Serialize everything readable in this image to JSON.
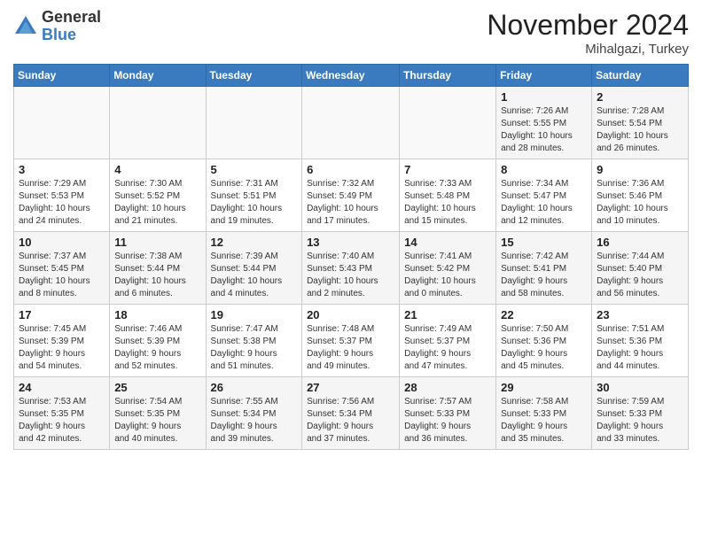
{
  "header": {
    "logo_general": "General",
    "logo_blue": "Blue",
    "month": "November 2024",
    "location": "Mihalgazi, Turkey"
  },
  "weekdays": [
    "Sunday",
    "Monday",
    "Tuesday",
    "Wednesday",
    "Thursday",
    "Friday",
    "Saturday"
  ],
  "weeks": [
    [
      {
        "day": "",
        "info": ""
      },
      {
        "day": "",
        "info": ""
      },
      {
        "day": "",
        "info": ""
      },
      {
        "day": "",
        "info": ""
      },
      {
        "day": "",
        "info": ""
      },
      {
        "day": "1",
        "info": "Sunrise: 7:26 AM\nSunset: 5:55 PM\nDaylight: 10 hours\nand 28 minutes."
      },
      {
        "day": "2",
        "info": "Sunrise: 7:28 AM\nSunset: 5:54 PM\nDaylight: 10 hours\nand 26 minutes."
      }
    ],
    [
      {
        "day": "3",
        "info": "Sunrise: 7:29 AM\nSunset: 5:53 PM\nDaylight: 10 hours\nand 24 minutes."
      },
      {
        "day": "4",
        "info": "Sunrise: 7:30 AM\nSunset: 5:52 PM\nDaylight: 10 hours\nand 21 minutes."
      },
      {
        "day": "5",
        "info": "Sunrise: 7:31 AM\nSunset: 5:51 PM\nDaylight: 10 hours\nand 19 minutes."
      },
      {
        "day": "6",
        "info": "Sunrise: 7:32 AM\nSunset: 5:49 PM\nDaylight: 10 hours\nand 17 minutes."
      },
      {
        "day": "7",
        "info": "Sunrise: 7:33 AM\nSunset: 5:48 PM\nDaylight: 10 hours\nand 15 minutes."
      },
      {
        "day": "8",
        "info": "Sunrise: 7:34 AM\nSunset: 5:47 PM\nDaylight: 10 hours\nand 12 minutes."
      },
      {
        "day": "9",
        "info": "Sunrise: 7:36 AM\nSunset: 5:46 PM\nDaylight: 10 hours\nand 10 minutes."
      }
    ],
    [
      {
        "day": "10",
        "info": "Sunrise: 7:37 AM\nSunset: 5:45 PM\nDaylight: 10 hours\nand 8 minutes."
      },
      {
        "day": "11",
        "info": "Sunrise: 7:38 AM\nSunset: 5:44 PM\nDaylight: 10 hours\nand 6 minutes."
      },
      {
        "day": "12",
        "info": "Sunrise: 7:39 AM\nSunset: 5:44 PM\nDaylight: 10 hours\nand 4 minutes."
      },
      {
        "day": "13",
        "info": "Sunrise: 7:40 AM\nSunset: 5:43 PM\nDaylight: 10 hours\nand 2 minutes."
      },
      {
        "day": "14",
        "info": "Sunrise: 7:41 AM\nSunset: 5:42 PM\nDaylight: 10 hours\nand 0 minutes."
      },
      {
        "day": "15",
        "info": "Sunrise: 7:42 AM\nSunset: 5:41 PM\nDaylight: 9 hours\nand 58 minutes."
      },
      {
        "day": "16",
        "info": "Sunrise: 7:44 AM\nSunset: 5:40 PM\nDaylight: 9 hours\nand 56 minutes."
      }
    ],
    [
      {
        "day": "17",
        "info": "Sunrise: 7:45 AM\nSunset: 5:39 PM\nDaylight: 9 hours\nand 54 minutes."
      },
      {
        "day": "18",
        "info": "Sunrise: 7:46 AM\nSunset: 5:39 PM\nDaylight: 9 hours\nand 52 minutes."
      },
      {
        "day": "19",
        "info": "Sunrise: 7:47 AM\nSunset: 5:38 PM\nDaylight: 9 hours\nand 51 minutes."
      },
      {
        "day": "20",
        "info": "Sunrise: 7:48 AM\nSunset: 5:37 PM\nDaylight: 9 hours\nand 49 minutes."
      },
      {
        "day": "21",
        "info": "Sunrise: 7:49 AM\nSunset: 5:37 PM\nDaylight: 9 hours\nand 47 minutes."
      },
      {
        "day": "22",
        "info": "Sunrise: 7:50 AM\nSunset: 5:36 PM\nDaylight: 9 hours\nand 45 minutes."
      },
      {
        "day": "23",
        "info": "Sunrise: 7:51 AM\nSunset: 5:36 PM\nDaylight: 9 hours\nand 44 minutes."
      }
    ],
    [
      {
        "day": "24",
        "info": "Sunrise: 7:53 AM\nSunset: 5:35 PM\nDaylight: 9 hours\nand 42 minutes."
      },
      {
        "day": "25",
        "info": "Sunrise: 7:54 AM\nSunset: 5:35 PM\nDaylight: 9 hours\nand 40 minutes."
      },
      {
        "day": "26",
        "info": "Sunrise: 7:55 AM\nSunset: 5:34 PM\nDaylight: 9 hours\nand 39 minutes."
      },
      {
        "day": "27",
        "info": "Sunrise: 7:56 AM\nSunset: 5:34 PM\nDaylight: 9 hours\nand 37 minutes."
      },
      {
        "day": "28",
        "info": "Sunrise: 7:57 AM\nSunset: 5:33 PM\nDaylight: 9 hours\nand 36 minutes."
      },
      {
        "day": "29",
        "info": "Sunrise: 7:58 AM\nSunset: 5:33 PM\nDaylight: 9 hours\nand 35 minutes."
      },
      {
        "day": "30",
        "info": "Sunrise: 7:59 AM\nSunset: 5:33 PM\nDaylight: 9 hours\nand 33 minutes."
      }
    ]
  ]
}
